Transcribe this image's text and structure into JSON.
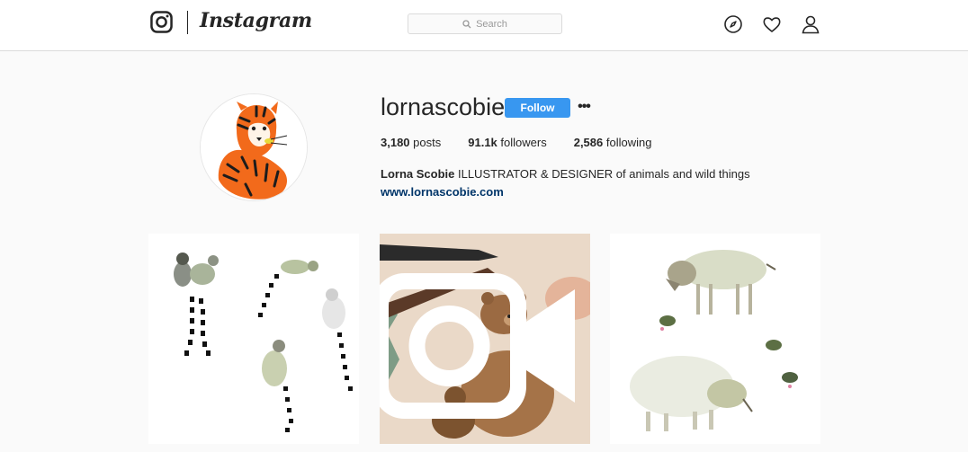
{
  "nav": {
    "brand": "Instagram",
    "search_placeholder": "Search",
    "icons": [
      "instagram-glyph-icon",
      "search-icon",
      "compass-icon",
      "heart-icon",
      "person-icon"
    ]
  },
  "profile": {
    "username": "lornascobie",
    "follow_label": "Follow",
    "more_label": "•••",
    "stats": {
      "posts_count": "3,180",
      "posts_label": "posts",
      "followers_count": "91.1k",
      "followers_label": "followers",
      "following_count": "2,586",
      "following_label": "following"
    },
    "bio": {
      "name": "Lorna Scobie",
      "text": "ILLUSTRATOR & DESIGNER of animals and wild things",
      "link": "www.lornascobie.com"
    },
    "avatar_icon": "tiger-illustration"
  },
  "posts": [
    {
      "subject": "lemurs-illustration",
      "video": false
    },
    {
      "subject": "bear-painting-video",
      "video": true
    },
    {
      "subject": "warthogs-illustration",
      "video": false
    }
  ],
  "colors": {
    "follow_button": "#3897f0",
    "link": "#003569",
    "border": "#dbdbdb",
    "background": "#fafafa"
  }
}
